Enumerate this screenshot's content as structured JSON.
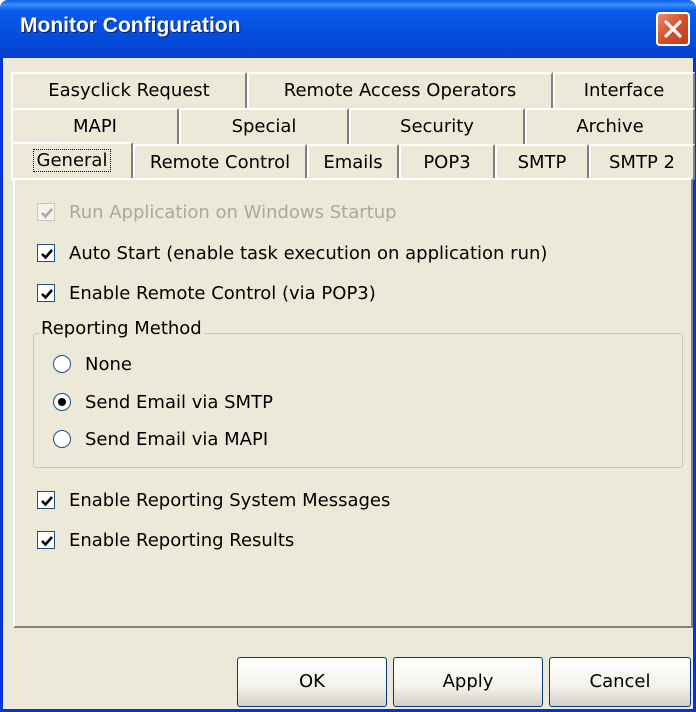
{
  "window": {
    "title": "Monitor Configuration"
  },
  "tabs": {
    "row1": [
      "Easyclick Request",
      "Remote Access Operators",
      "Interface"
    ],
    "row2": [
      "MAPI",
      "Special",
      "Security",
      "Archive"
    ],
    "row3": [
      "General",
      "Remote Control",
      "Emails",
      "POP3",
      "SMTP",
      "SMTP 2"
    ],
    "active": "General"
  },
  "general": {
    "run_on_startup": {
      "label": "Run Application on Windows Startup",
      "checked": true,
      "disabled": true
    },
    "auto_start": {
      "label": "Auto Start (enable task execution on application run)",
      "checked": true
    },
    "enable_remote_control": {
      "label": "Enable Remote Control (via POP3)",
      "checked": true
    },
    "reporting_method": {
      "title": "Reporting Method",
      "options": [
        "None",
        "Send Email via SMTP",
        "Send Email via MAPI"
      ],
      "selected": "Send Email via SMTP"
    },
    "enable_reporting_system_messages": {
      "label": "Enable Reporting System Messages",
      "checked": true
    },
    "enable_reporting_results": {
      "label": "Enable Reporting Results",
      "checked": true
    }
  },
  "buttons": {
    "ok": "OK",
    "apply": "Apply",
    "cancel": "Cancel"
  },
  "icons": {
    "close": "close-icon",
    "check": "check-icon"
  }
}
